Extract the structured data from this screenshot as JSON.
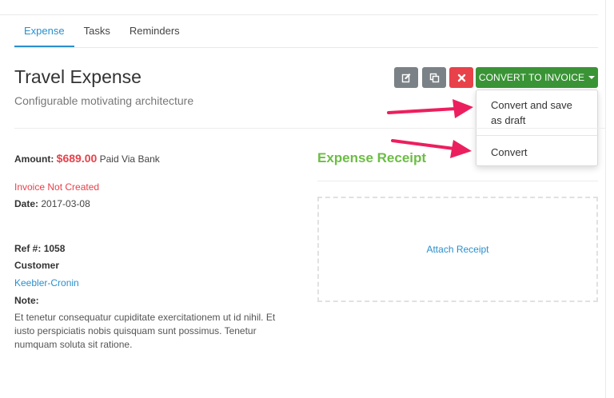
{
  "tabs": [
    {
      "label": "Expense",
      "active": true
    },
    {
      "label": "Tasks",
      "active": false
    },
    {
      "label": "Reminders",
      "active": false
    }
  ],
  "expense": {
    "title": "Travel Expense",
    "subtitle": "Configurable motivating architecture",
    "amount_label": "Amount:",
    "amount_value": "$689.00",
    "payment_method": "Paid Via Bank",
    "invoice_status": "Invoice Not Created",
    "date_label": "Date:",
    "date_value": "2017-03-08",
    "ref_label": "Ref #:",
    "ref_value": "1058",
    "customer_label": "Customer",
    "customer_value": "Keebler-Cronin",
    "note_label": "Note:",
    "note_text": "Et tenetur consequatur cupiditate exercitationem ut id nihil. Et iusto perspiciatis nobis quisquam sunt possimus. Tenetur numquam soluta sit ratione."
  },
  "toolbar": {
    "edit_icon": "edit-icon",
    "copy_icon": "copy-icon",
    "delete_icon": "close-icon",
    "convert_label": "CONVERT TO INVOICE"
  },
  "dropdown": {
    "items": [
      "Convert and save as draft",
      "Convert"
    ]
  },
  "receipt": {
    "title": "Expense Receipt",
    "attach_label": "Attach Receipt"
  },
  "colors": {
    "accent": "#2a8fce",
    "success": "#3a9436",
    "danger": "#e8414a",
    "receipt_title": "#6cbd45",
    "arrow": "#ec1f5e"
  }
}
